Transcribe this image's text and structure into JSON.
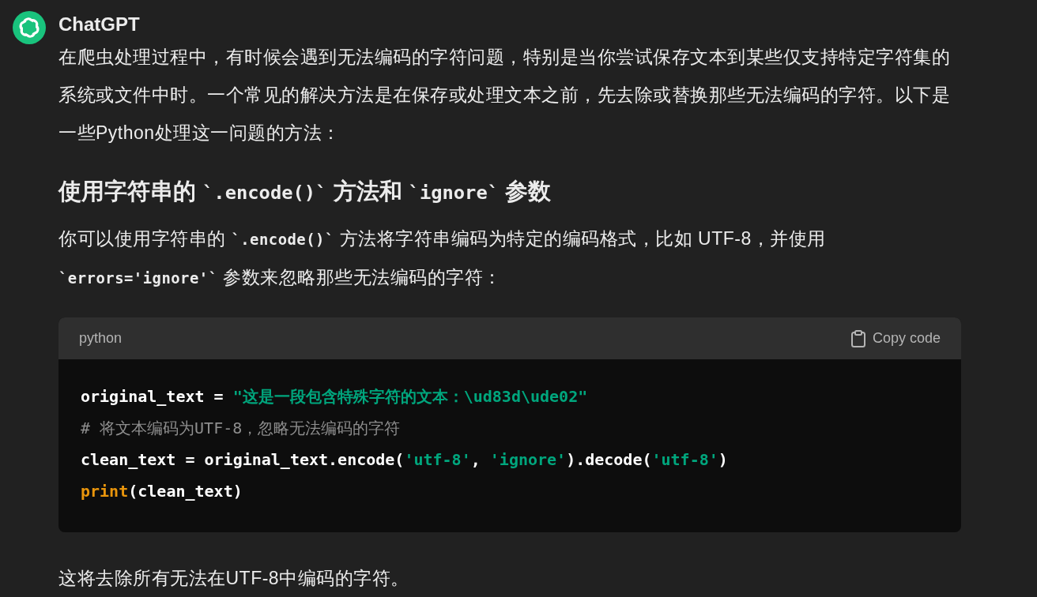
{
  "message": {
    "author": "ChatGPT",
    "intro": "在爬虫处理过程中，有时候会遇到无法编码的字符问题，特别是当你尝试保存文本到某些仅支持特定字符集的系统或文件中时。一个常见的解决方法是在保存或处理文本之前，先去除或替换那些无法编码的字符。以下是一些Python处理这一问题的方法：",
    "heading": [
      {
        "kind": "text",
        "text": "使用字符串的 "
      },
      {
        "kind": "code",
        "text": "`.encode()`"
      },
      {
        "kind": "text",
        "text": " 方法和 "
      },
      {
        "kind": "code",
        "text": "`ignore`"
      },
      {
        "kind": "text",
        "text": " 参数"
      }
    ],
    "paragraph": [
      {
        "kind": "text",
        "text": "你可以使用字符串的 "
      },
      {
        "kind": "code",
        "text": "`.encode()`"
      },
      {
        "kind": "text",
        "text": " 方法将字符串编码为特定的编码格式，比如 UTF-8，并使用 "
      },
      {
        "kind": "code",
        "text": "`errors='ignore'`"
      },
      {
        "kind": "text",
        "text": " 参数来忽略那些无法编码的字符："
      }
    ],
    "code_block": {
      "language": "python",
      "copy_label": "Copy code",
      "lines": [
        [
          {
            "kind": "plain",
            "text": "original_text = "
          },
          {
            "kind": "string",
            "text": "\"这是一段包含特殊字符的文本：\\ud83d\\ude02\""
          }
        ],
        [
          {
            "kind": "comment",
            "text": "# 将文本编码为UTF-8，忽略无法编码的字符"
          }
        ],
        [
          {
            "kind": "plain",
            "text": "clean_text = original_text.encode("
          },
          {
            "kind": "string",
            "text": "'utf-8'"
          },
          {
            "kind": "plain",
            "text": ", "
          },
          {
            "kind": "string",
            "text": "'ignore'"
          },
          {
            "kind": "plain",
            "text": ").decode("
          },
          {
            "kind": "string",
            "text": "'utf-8'"
          },
          {
            "kind": "plain",
            "text": ")"
          }
        ],
        [
          {
            "kind": "builtin",
            "text": "print"
          },
          {
            "kind": "plain",
            "text": "(clean_text)"
          }
        ]
      ]
    },
    "outro": "这将去除所有无法在UTF-8中编码的字符。"
  }
}
